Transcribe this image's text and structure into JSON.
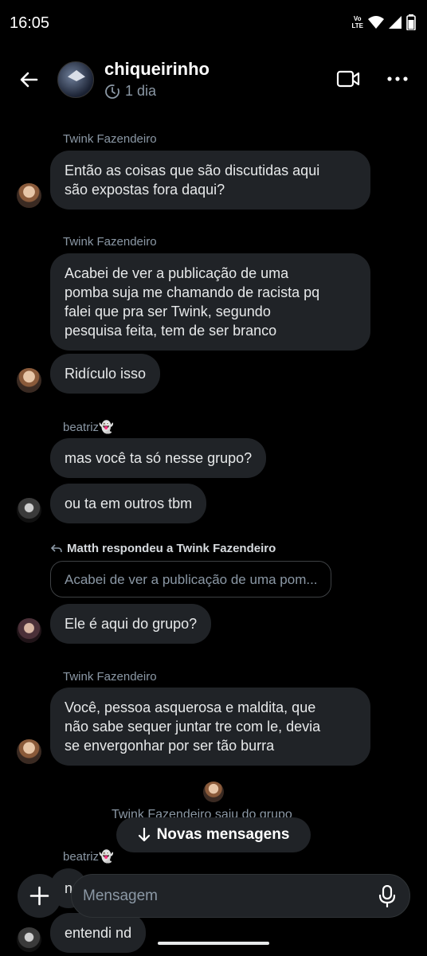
{
  "status": {
    "time": "16:05",
    "volte_top": "Vo",
    "volte_bottom": "LTE"
  },
  "header": {
    "group_name": "chiqueirinho",
    "last_seen": "1 dia"
  },
  "messages": [
    {
      "sender": "Twink Fazendeiro",
      "text_lines": [
        "Então as coisas que são discutidas aqui",
        "são expostas fora daqui?"
      ]
    },
    {
      "sender": "Twink Fazendeiro",
      "text_lines": [
        "Acabei de ver a publicação de uma",
        "pomba suja me chamando de racista pq",
        "falei que pra ser Twink, segundo",
        "pesquisa feita, tem de ser branco"
      ]
    },
    {
      "text": "Ridículo isso"
    },
    {
      "sender": "beatriz👻",
      "text": "mas você ta só nesse grupo?"
    },
    {
      "text": "ou ta em outros tbm"
    },
    {
      "reply_header": "Matth respondeu a Twink Fazendeiro",
      "quote": "Acabei de ver a publicação de uma pom...",
      "text": "Ele é aqui do grupo?"
    },
    {
      "sender": "Twink Fazendeiro",
      "text_lines": [
        "Você, pessoa asquerosa e maldita, que",
        "não sabe sequer juntar tre com le, devia",
        "se envergonhar por ser tão burra"
      ]
    },
    {
      "system": "Twink Fazendeiro saiu do grupo"
    },
    {
      "sender": "beatriz👻",
      "text": "n"
    },
    {
      "text": "entendi nd"
    }
  ],
  "new_messages_label": "Novas mensagens",
  "composer": {
    "placeholder": "Mensagem"
  }
}
